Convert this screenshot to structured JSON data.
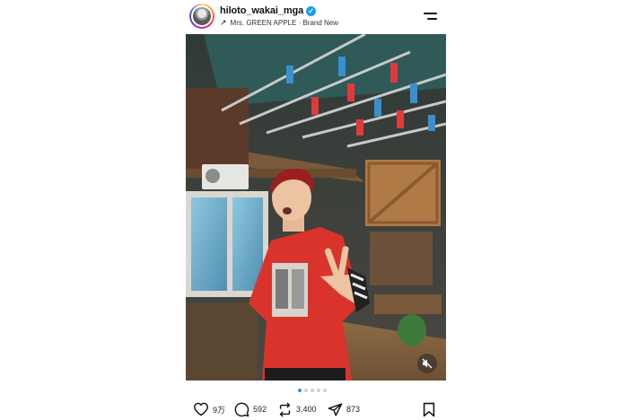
{
  "post": {
    "username": "hiloto_wakai_mga",
    "verified_icon": "verified-check-icon",
    "music_arrow": "↗",
    "music": "Mrs. GREEN APPLE · Brand New",
    "photo_alt": "",
    "carousel": {
      "count": 5,
      "active_index": 0
    },
    "actions": {
      "likes": "9万",
      "comments": "592",
      "reposts": "3,400",
      "shares": "873"
    },
    "icons": [
      "heart-icon",
      "comment-icon",
      "repost-icon",
      "send-icon",
      "bookmark-icon",
      "menu-icon",
      "mute-icon"
    ],
    "colors": {
      "accent": "#1d9bf0",
      "text": "#111111"
    }
  }
}
